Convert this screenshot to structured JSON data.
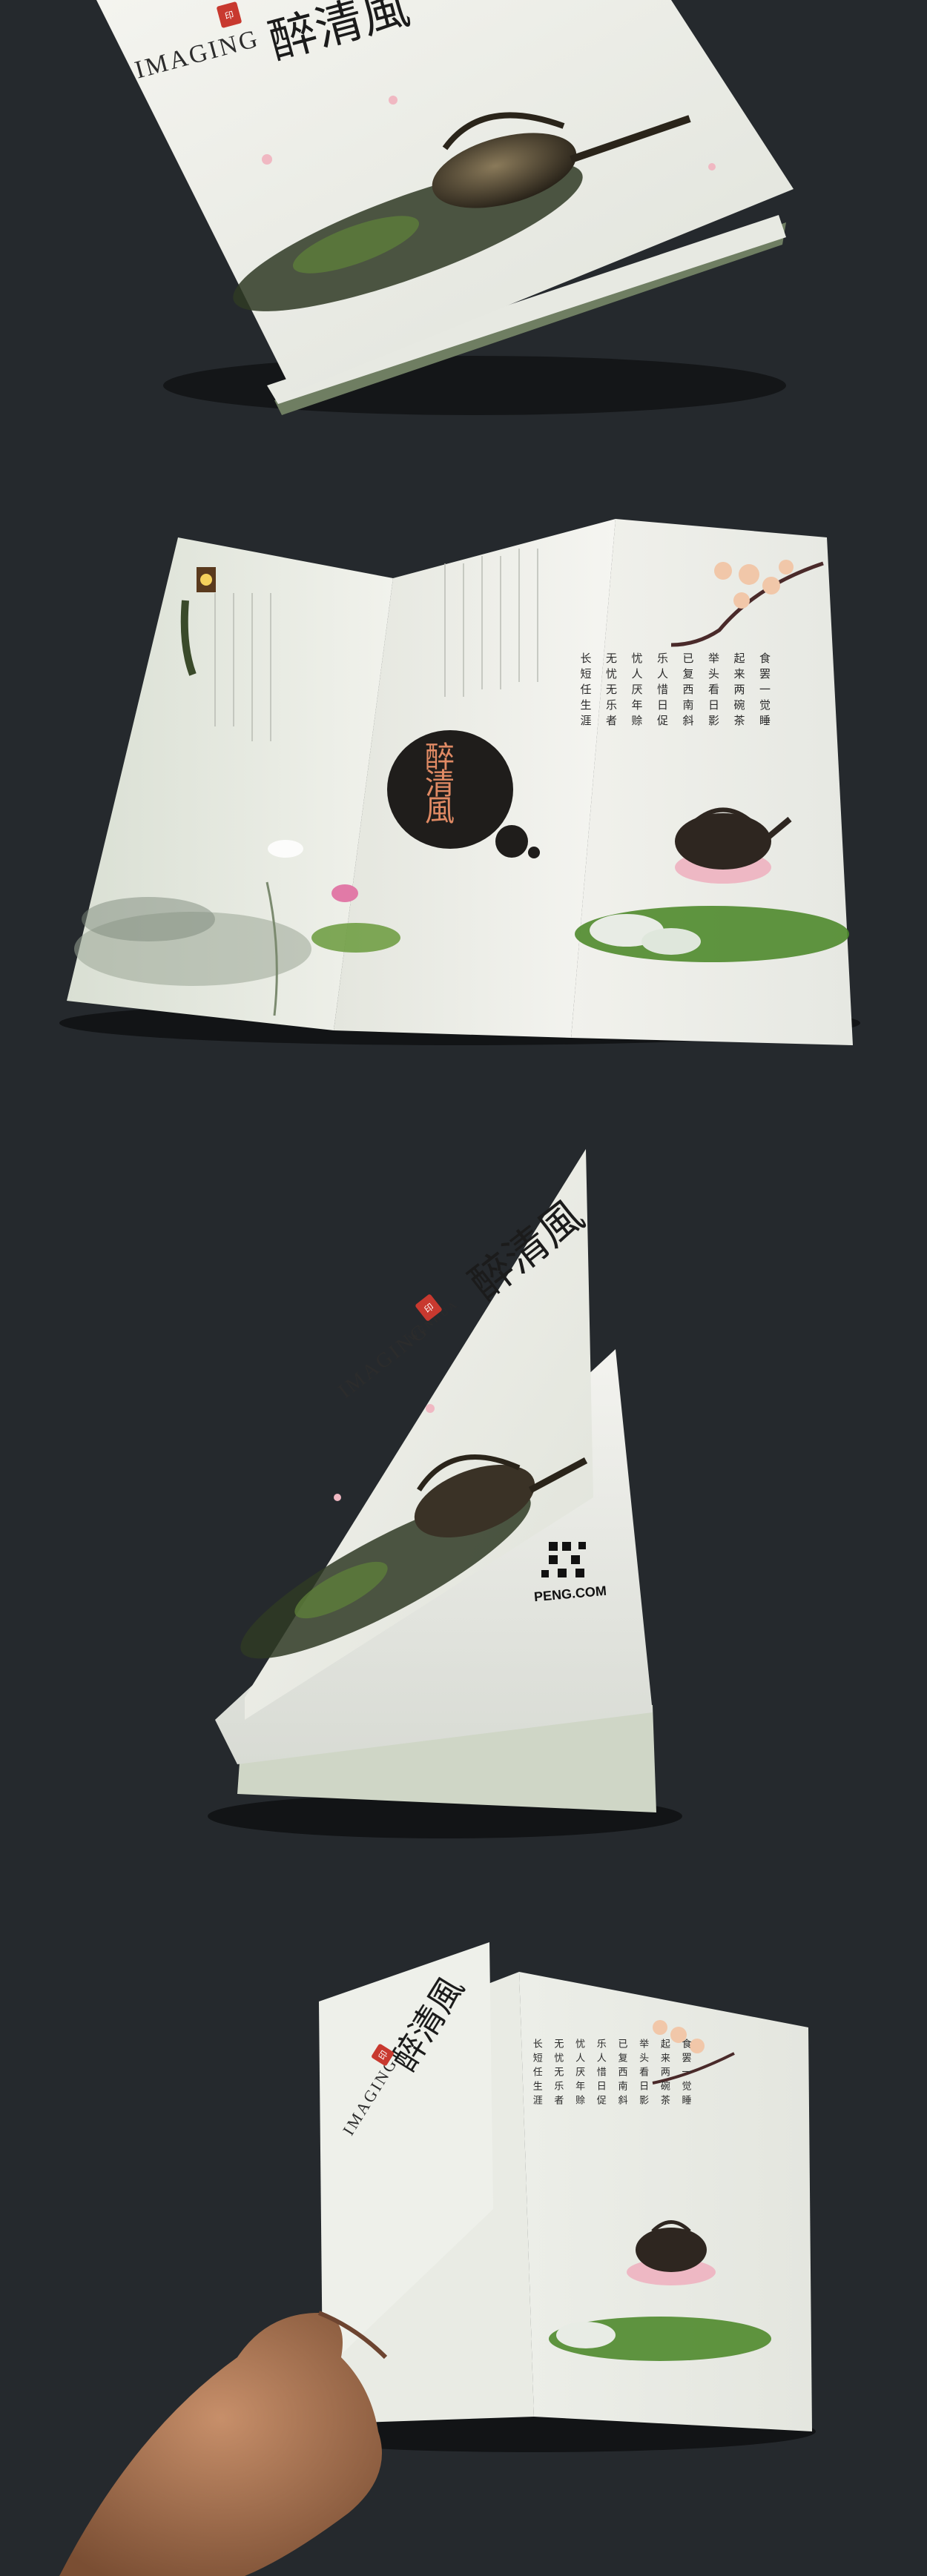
{
  "brand": {
    "english": "IMAGING",
    "english_sub": "WENHUA",
    "chinese_title": "醉清風",
    "seal_text": "印"
  },
  "website": "PENG.COM",
  "poem": {
    "columns": [
      "食罢一觉睡",
      "起来两碗茶",
      "举头看日影",
      "已复西南斜",
      "乐人惜日促",
      "忧人厌年赊",
      "无忧无乐者",
      "长短任生涯"
    ]
  },
  "colors": {
    "background": "#25292d",
    "paper": "#f0f0eb",
    "accent_red": "#c8392f",
    "ink": "#1b1b1b"
  }
}
